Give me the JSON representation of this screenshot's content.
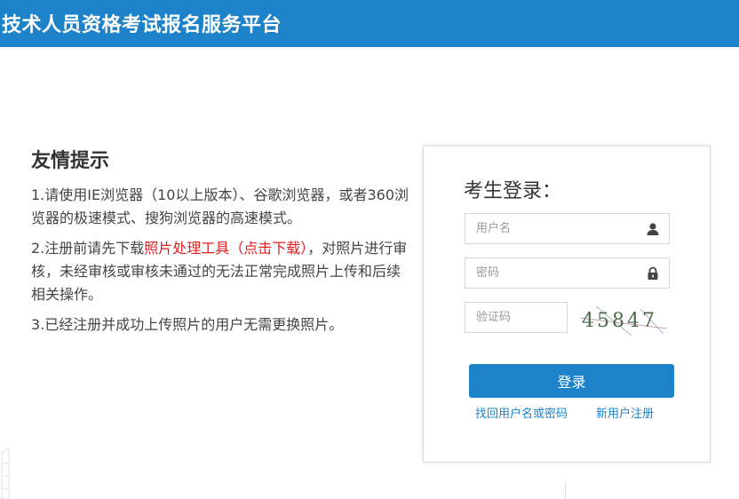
{
  "header": {
    "title": "技术人员资格考试报名服务平台",
    "bg_color": "#1e82c9"
  },
  "tips": {
    "title": "友情提示",
    "item1": "1.请使用IE浏览器（10以上版本）、谷歌浏览器，或者360浏览器的极速模式、搜狗浏览器的高速模式。",
    "item2_prefix": "2.注册前请先下载",
    "item2_link": "照片处理工具（点击下载）",
    "item2_suffix": "，对照片进行审核，未经审核或审核未通过的无法正常完成照片上传和后续相关操作。",
    "item3": "3.已经注册并成功上传照片的用户无需更换照片。",
    "link_color": "#e02020"
  },
  "login": {
    "title": "考生登录：",
    "username_placeholder": "用户名",
    "password_placeholder": "密码",
    "captcha_placeholder": "验证码",
    "captcha_text": "45847",
    "submit_label": "登录",
    "forgot_link": "找回用户名或密码",
    "register_link": "新用户注册",
    "accent_color": "#1e82c9"
  },
  "icons": {
    "username": "user-icon",
    "password": "lock-icon"
  }
}
